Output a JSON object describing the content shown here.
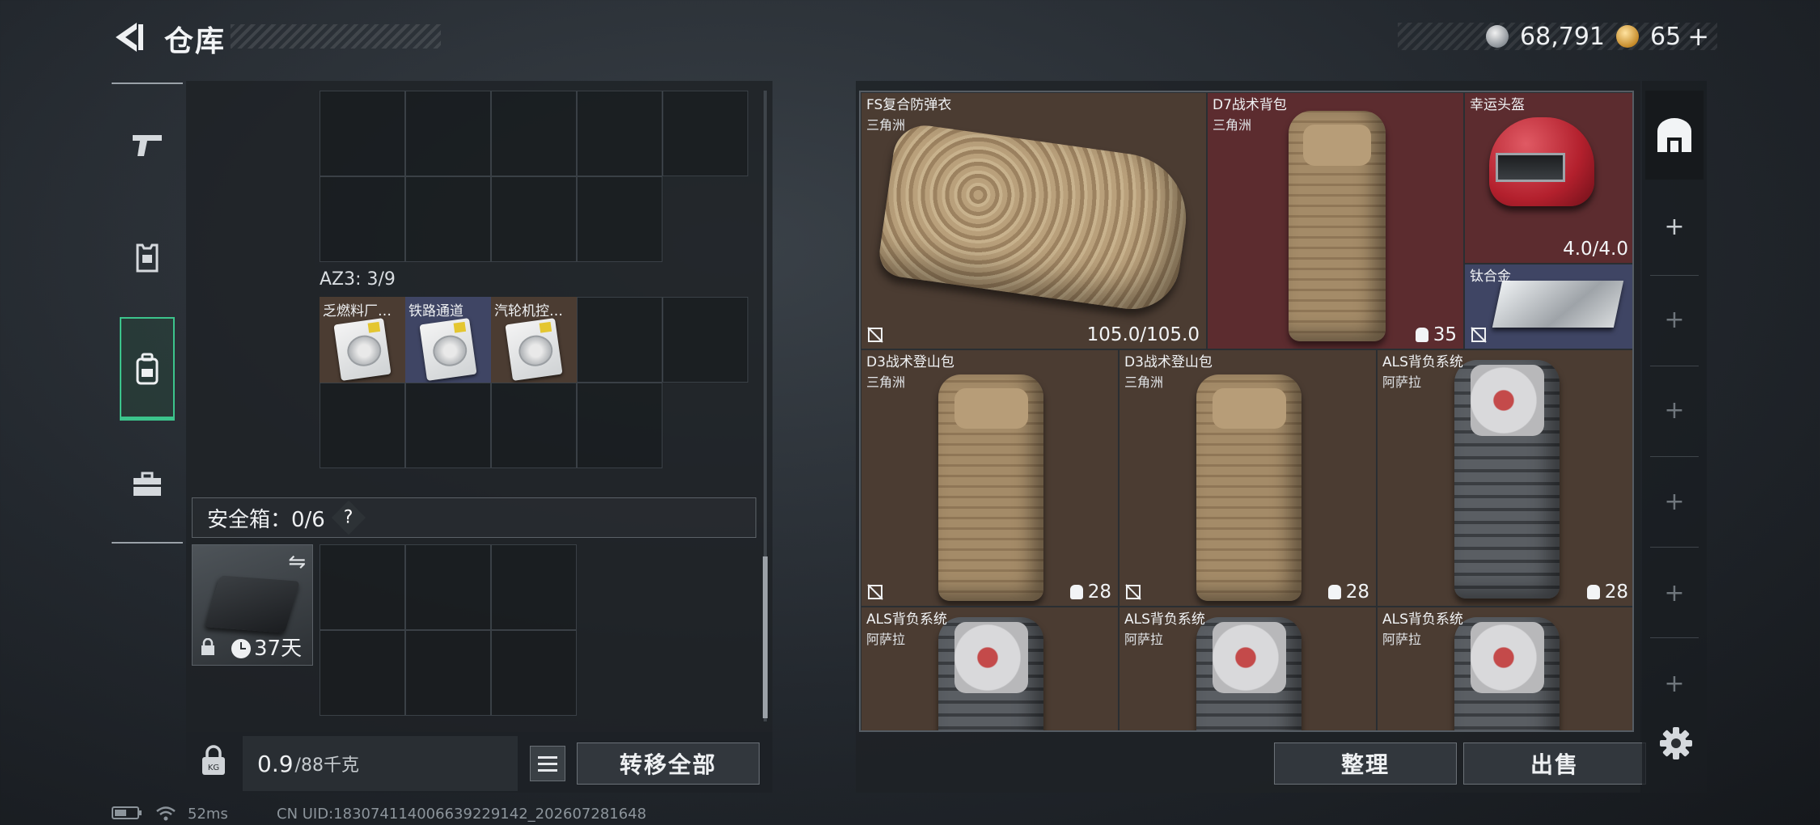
{
  "header": {
    "title": "仓库",
    "currency": [
      {
        "icon": "silver-coin-icon",
        "value": "68,791"
      },
      {
        "icon": "gold-coin-icon",
        "value": "65"
      }
    ],
    "add_label": "+"
  },
  "nav": [
    {
      "icon": "pistol-icon",
      "active": false
    },
    {
      "icon": "armor-icon",
      "active": false
    },
    {
      "icon": "backpack-icon",
      "active": true
    },
    {
      "icon": "toolbox-icon",
      "active": false
    }
  ],
  "left": {
    "az3_label": "AZ3: 3/9",
    "az3_items": [
      {
        "name": "乏燃料厂…",
        "color": "#4b3c32"
      },
      {
        "name": "铁路通道",
        "color": "#3f4564"
      },
      {
        "name": "汽轮机控…",
        "color": "#4b3c32"
      }
    ],
    "safe_label": "安全箱：0/6",
    "help": "?",
    "safe_days": "37天",
    "weight_value": "0.9",
    "weight_unit": "/88千克",
    "transfer_all": "转移全部"
  },
  "stash": {
    "items": [
      {
        "name": "FS复合防弹衣",
        "sub": "三角洲",
        "value": "105.0/105.0",
        "color": "brown"
      },
      {
        "name": "D7战术背包",
        "sub": "三角洲",
        "value": "35",
        "color": "red"
      },
      {
        "name": "幸运头盔",
        "sub": "",
        "value": "4.0/4.0",
        "color": "red"
      },
      {
        "name": "钛合金",
        "sub": "",
        "value": "",
        "color": "purple"
      },
      {
        "name": "D3战术登山包",
        "sub": "三角洲",
        "value": "28",
        "color": "brown"
      },
      {
        "name": "D3战术登山包",
        "sub": "三角洲",
        "value": "28",
        "color": "brown"
      },
      {
        "name": "ALS背负系统",
        "sub": "阿萨拉",
        "value": "28",
        "color": "brown"
      },
      {
        "name": "ALS背负系统",
        "sub": "阿萨拉",
        "value": "",
        "color": "brown"
      },
      {
        "name": "ALS背负系统",
        "sub": "阿萨拉",
        "value": "",
        "color": "brown"
      },
      {
        "name": "ALS背负系统",
        "sub": "阿萨拉",
        "value": "",
        "color": "brown"
      }
    ],
    "organize": "整理",
    "sell": "出售"
  },
  "status": {
    "ping": "52ms",
    "uid": "CN UID:18307411400663922914​2_202607281648"
  },
  "colors": {
    "accent_green": "#3cc48c",
    "rarity_red": "#5c2c2f",
    "rarity_purple": "#3f4564",
    "rarity_brown": "#4b3c32"
  }
}
